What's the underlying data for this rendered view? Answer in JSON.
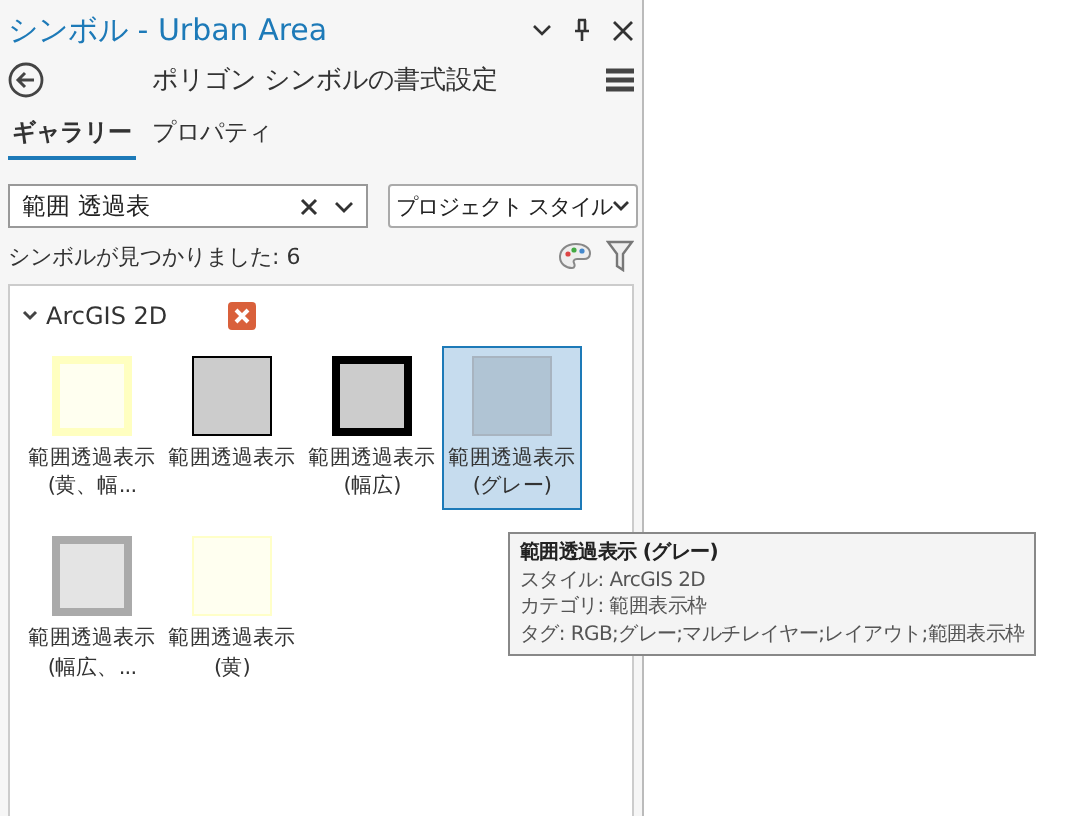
{
  "window": {
    "title": "シンボル - Urban Area"
  },
  "header": {
    "title": "ポリゴン シンボルの書式設定"
  },
  "tabs": [
    {
      "label": "ギャラリー",
      "selected": true
    },
    {
      "label": "プロパティ",
      "selected": false
    }
  ],
  "search": {
    "value": "範囲 透過表",
    "style_dropdown": "プロジェクト スタイル"
  },
  "count": "シンボルが見つかりました: 6",
  "group": {
    "name": "ArcGIS 2D",
    "expanded": true
  },
  "symbols": [
    {
      "kind": "yellow-wide",
      "label": "範囲透過表示 (黄、幅...",
      "selected": false
    },
    {
      "kind": "gray-thin",
      "label": "範囲透過表示",
      "selected": false
    },
    {
      "kind": "gray-thick",
      "label": "範囲透過表示 (幅広)",
      "selected": false
    },
    {
      "kind": "gray-faint",
      "label": "範囲透過表示 (グレー)",
      "selected": true
    },
    {
      "kind": "gray-wide",
      "label": "範囲透過表示 (幅広、...",
      "selected": false
    },
    {
      "kind": "yellow-thin",
      "label": "範囲透過表示 (黄)",
      "selected": false
    }
  ],
  "tooltip": {
    "title": "範囲透過表示 (グレー)",
    "lines": [
      "スタイル: ArcGIS 2D",
      "カテゴリ: 範囲表示枠",
      "タグ: RGB;グレー;マルチレイヤー;レイアウト;範囲表示枠"
    ]
  }
}
